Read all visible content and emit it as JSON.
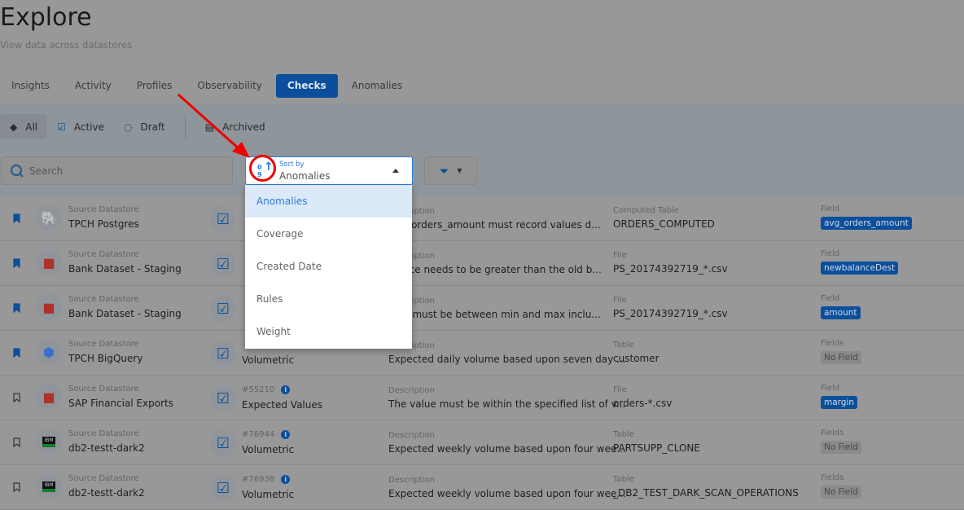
{
  "header": {
    "title": "Explore",
    "subtitle": "View data across datastores"
  },
  "tabs": [
    {
      "label": "Insights"
    },
    {
      "label": "Activity"
    },
    {
      "label": "Profiles"
    },
    {
      "label": "Observability"
    },
    {
      "label": "Checks",
      "active": true
    },
    {
      "label": "Anomalies"
    }
  ],
  "status_filters": [
    {
      "label": "All",
      "icon": "layers-icon"
    },
    {
      "label": "Active",
      "icon": "check-square-icon"
    },
    {
      "label": "Draft",
      "icon": "dashed-check-circle-icon"
    },
    {
      "label": "Archived",
      "icon": "archive-icon"
    }
  ],
  "search": {
    "placeholder": "Search"
  },
  "sort": {
    "label": "Sort by",
    "value": "Anomalies",
    "icon_text_top": "0",
    "icon_text_bottom": "9",
    "options": [
      "Anomalies",
      "Coverage",
      "Created Date",
      "Rules",
      "Weight"
    ]
  },
  "colors": {
    "accent": "#0b4f9c",
    "link": "#2d7be0",
    "annotation": "#e00000"
  },
  "labels": {
    "source": "Source Datastore",
    "description": "Description"
  },
  "rows": [
    {
      "bookmarked": true,
      "ds_icon": "postgres",
      "datastore": "TPCH Postgres",
      "id": "",
      "type": "",
      "description": "avg_orders_amount must record values d...",
      "asset_label": "Computed Table",
      "asset": "ORDERS_COMPUTED",
      "field_label": "Field",
      "field": "avg_orders_amount"
    },
    {
      "bookmarked": true,
      "ds_icon": "s3",
      "datastore": "Bank Dataset - Staging",
      "id": "",
      "type": "",
      "description": "balace needs to be greater than the old b...",
      "asset_label": "File",
      "asset": "PS_20174392719_*.csv",
      "field_label": "Field",
      "field": "newbalanceDest"
    },
    {
      "bookmarked": true,
      "ds_icon": "s3",
      "datastore": "Bank Dataset - Staging",
      "id": "",
      "type": "",
      "description": "alue must be between min and max inclu...",
      "asset_label": "File",
      "asset": "PS_20174392719_*.csv",
      "field_label": "Field",
      "field": "amount"
    },
    {
      "bookmarked": true,
      "ds_icon": "bigquery",
      "datastore": "TPCH BigQuery",
      "id": "",
      "type": "Volumetric",
      "description": "Expected daily volume based upon seven day ...",
      "asset_label": "Table",
      "asset": "customer",
      "field_label": "Fields",
      "field": "No Field"
    },
    {
      "bookmarked": false,
      "ds_icon": "s3",
      "datastore": "SAP Financial Exports",
      "id": "#55210",
      "type": "Expected Values",
      "description": "The value must be within the specified list of v...",
      "asset_label": "File",
      "asset": "orders-*.csv",
      "field_label": "Field",
      "field": "margin"
    },
    {
      "bookmarked": false,
      "ds_icon": "db2",
      "datastore": "db2-testt-dark2",
      "id": "#76944",
      "type": "Volumetric",
      "description": "Expected weekly volume based upon four wee...",
      "asset_label": "Table",
      "asset": "PARTSUPP_CLONE",
      "field_label": "Fields",
      "field": "No Field"
    },
    {
      "bookmarked": false,
      "ds_icon": "db2",
      "datastore": "db2-testt-dark2",
      "id": "#76938",
      "type": "Volumetric",
      "description": "Expected weekly volume based upon four wee...",
      "asset_label": "Table",
      "asset": "_DB2_TEST_DARK_SCAN_OPERATIONS",
      "field_label": "Fields",
      "field": "No Field"
    }
  ]
}
